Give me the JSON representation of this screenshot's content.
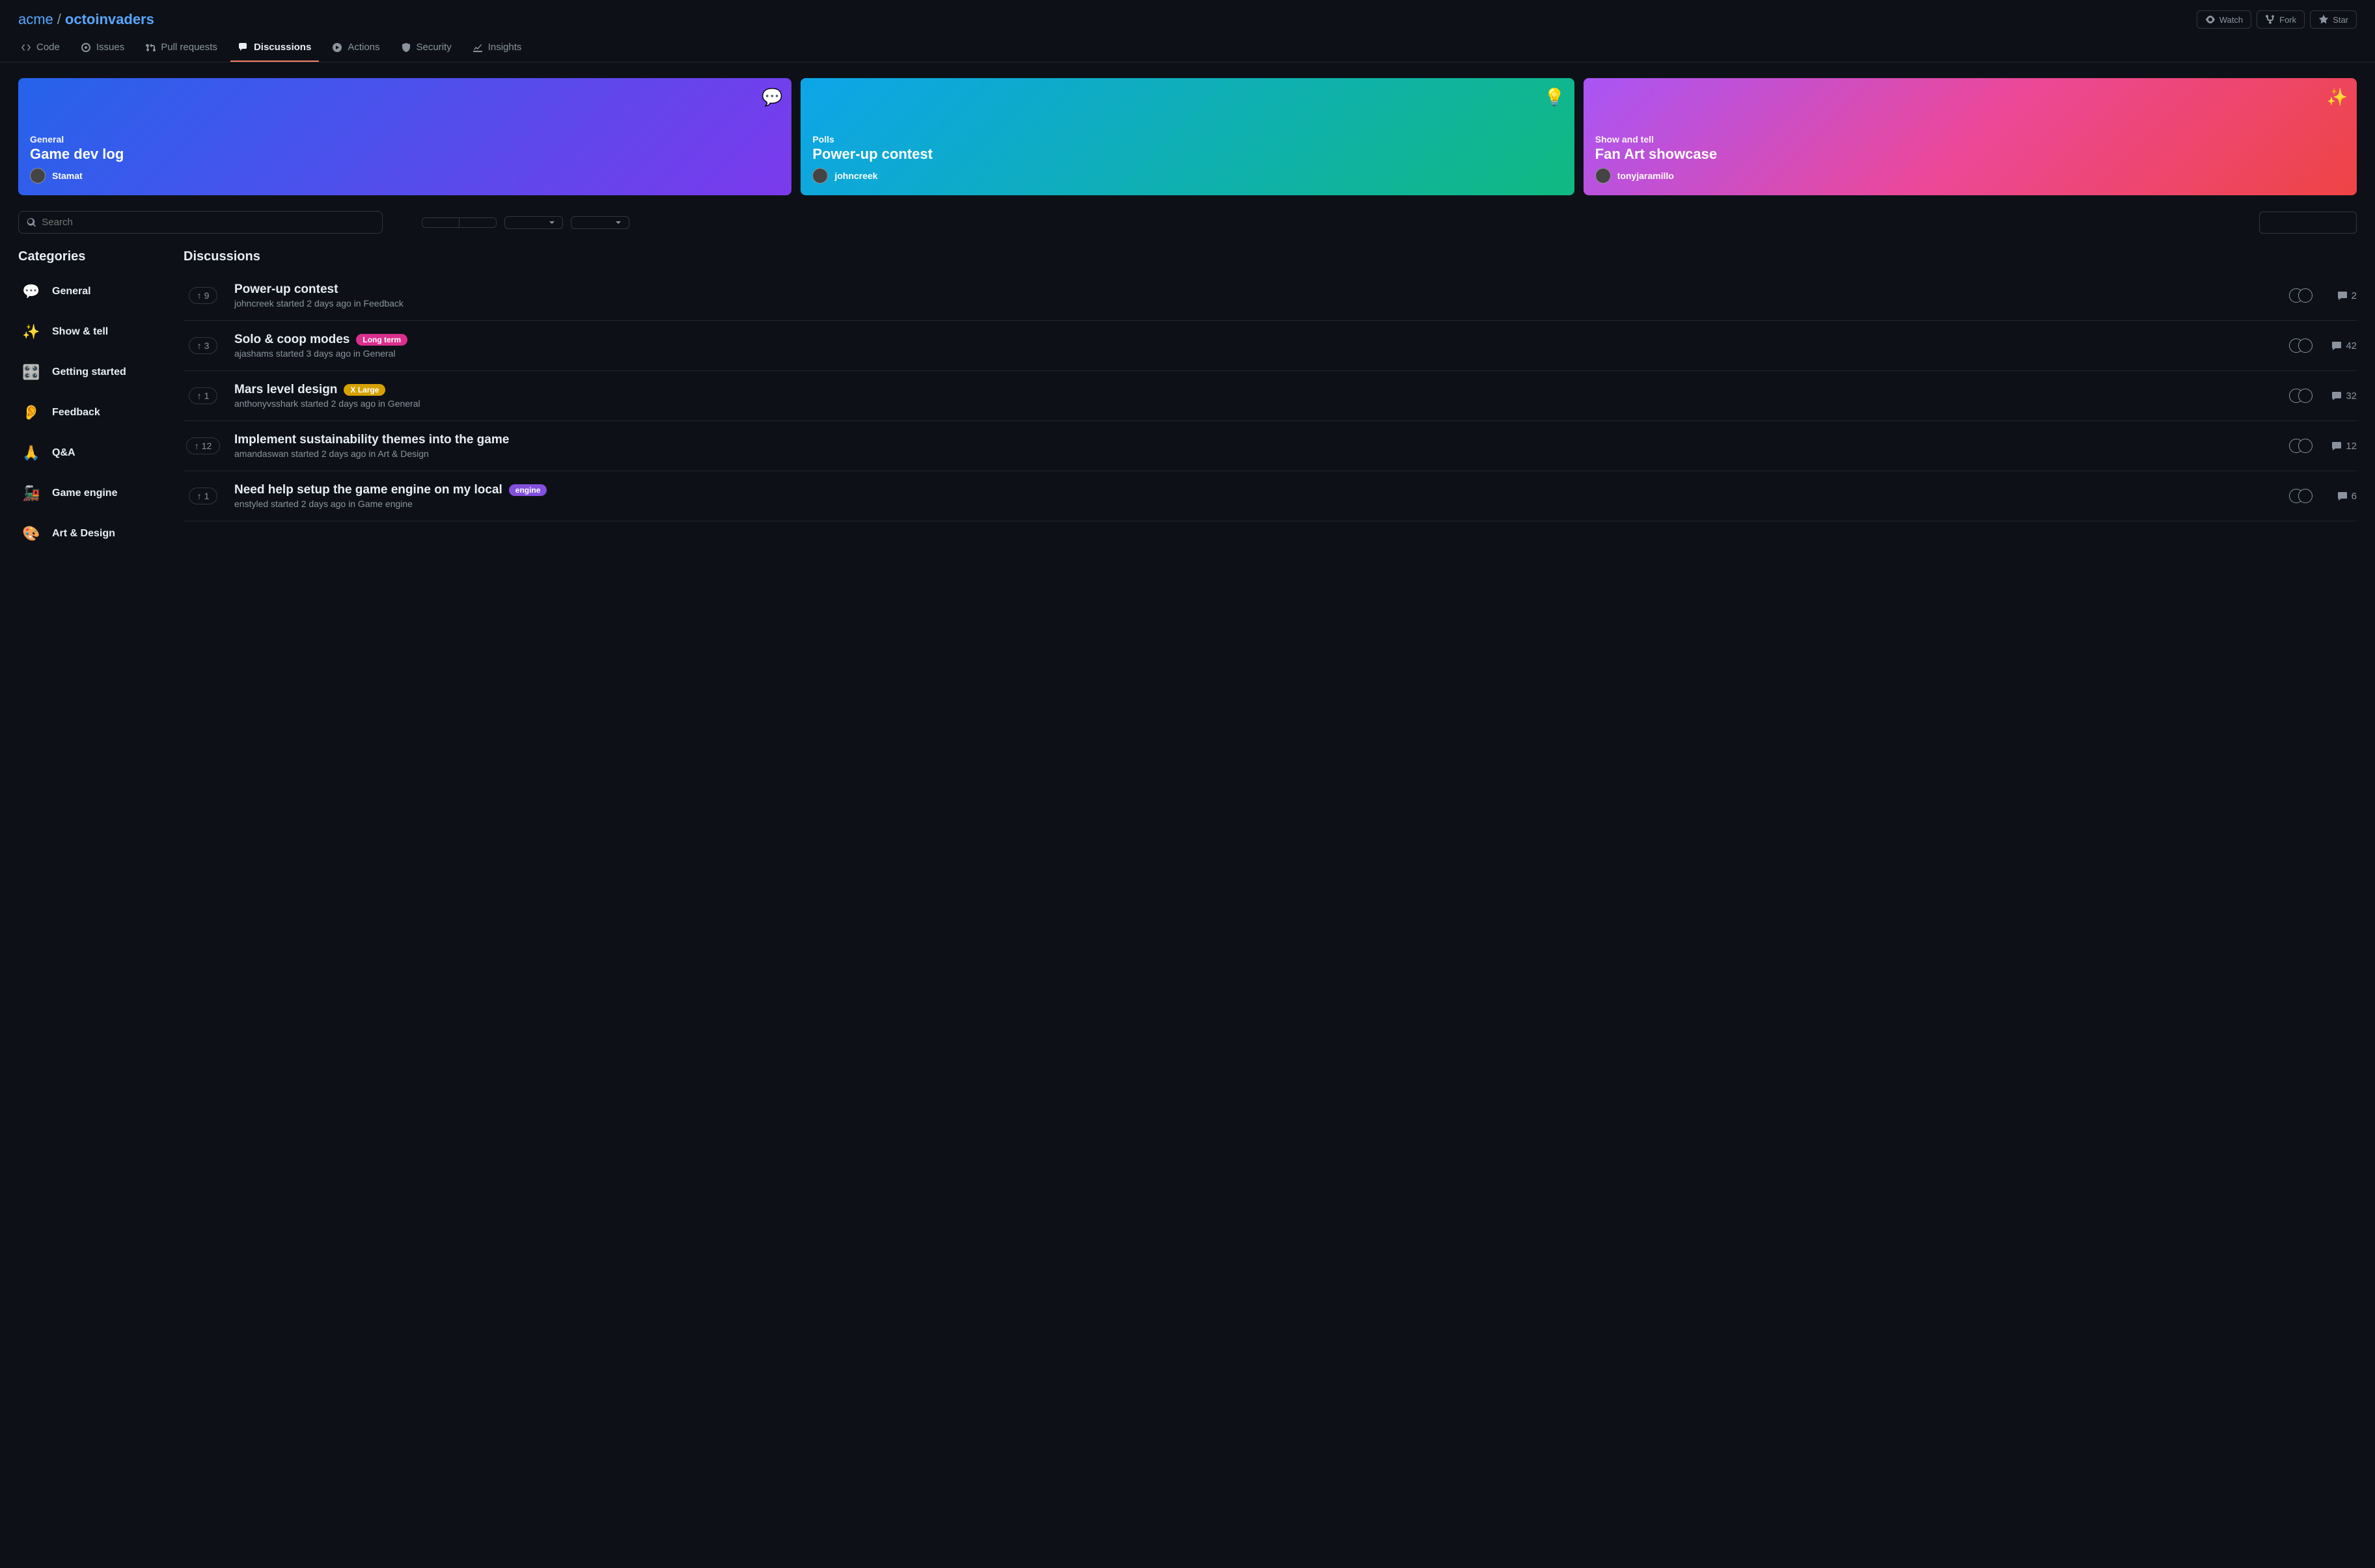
{
  "repo": {
    "owner": "acme",
    "name": "octoinvaders",
    "sep": "/"
  },
  "actions": {
    "watch": "Watch",
    "fork": "Fork",
    "star": "Star"
  },
  "nav": {
    "code": "Code",
    "issues": "Issues",
    "pulls": "Pull requests",
    "discussions": "Discussions",
    "actions": "Actions",
    "security": "Security",
    "insights": "Insights"
  },
  "spotlights": [
    {
      "category": "General",
      "title": "Game dev log",
      "author": "Stamat",
      "emoji": "💬"
    },
    {
      "category": "Polls",
      "title": "Power-up contest",
      "author": "johncreek",
      "emoji": "💡"
    },
    {
      "category": "Show and tell",
      "title": "Fan Art showcase",
      "author": "tonyjaramillo",
      "emoji": "✨"
    }
  ],
  "search": {
    "placeholder": "Search"
  },
  "sidebar": {
    "heading": "Categories",
    "items": [
      {
        "emoji": "💬",
        "label": "General"
      },
      {
        "emoji": "✨",
        "label": "Show & tell"
      },
      {
        "emoji": "🎛️",
        "label": "Getting started"
      },
      {
        "emoji": "👂",
        "label": "Feedback"
      },
      {
        "emoji": "🙏",
        "label": "Q&A"
      },
      {
        "emoji": "🚂",
        "label": "Game engine"
      },
      {
        "emoji": "🎨",
        "label": "Art & Design"
      }
    ]
  },
  "list": {
    "heading": "Discussions",
    "items": [
      {
        "votes": "9",
        "title": "Power-up contest",
        "label": null,
        "meta": "johncreek started 2 days ago in Feedback",
        "comments": "2"
      },
      {
        "votes": "3",
        "title": "Solo & coop modes",
        "label": {
          "text": "Long term",
          "bg": "#db2f8e"
        },
        "meta": "ajashams started 3 days ago in General",
        "comments": "42"
      },
      {
        "votes": "1",
        "title": "Mars level design",
        "label": {
          "text": "X Large",
          "bg": "#d7a100"
        },
        "meta": "anthonyvsshark started 2 days ago in General",
        "comments": "32"
      },
      {
        "votes": "12",
        "title": "Implement sustainability themes into the game",
        "label": null,
        "meta": "amandaswan started 2 days ago in Art & Design",
        "comments": "12"
      },
      {
        "votes": "1",
        "title": "Need help setup the game engine on my local",
        "label": {
          "text": "engine",
          "bg": "#8250df"
        },
        "meta": "enstyled started 2 days ago in Game engine",
        "comments": "6"
      }
    ]
  }
}
